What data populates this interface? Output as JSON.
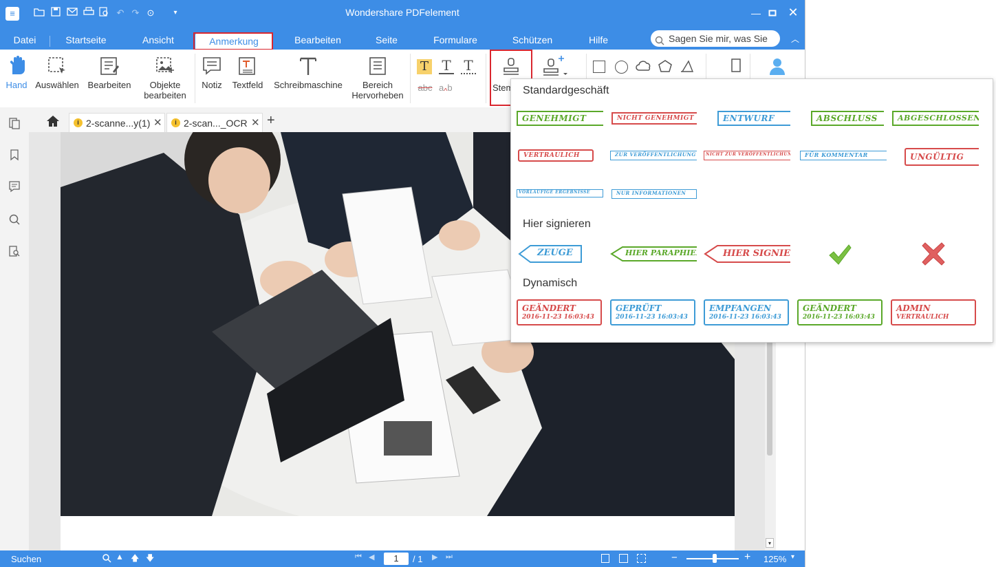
{
  "app": {
    "title": "Wondershare PDFelement"
  },
  "menu": {
    "file": "Datei",
    "tabs": [
      "Startseite",
      "Ansicht",
      "Anmerkung",
      "Bearbeiten",
      "Seite",
      "Formulare",
      "Schützen",
      "Hilfe"
    ],
    "active_tab": "Anmerkung",
    "search_placeholder": "Sagen Sie mir, was Sie tun"
  },
  "ribbon": {
    "hand": "Hand",
    "select": "Auswählen",
    "edit": "Bearbeiten",
    "objects_line1": "Objekte",
    "objects_line2": "bearbeiten",
    "note": "Notiz",
    "textbox": "Textfeld",
    "typewriter": "Schreibmaschine",
    "area_line1": "Bereich",
    "area_line2": "Hervorheben",
    "strike": "abc",
    "stamp": "Stem"
  },
  "doc_tabs": [
    {
      "label": "2-scanne...y(1)"
    },
    {
      "label": "2-scan..._OCR"
    }
  ],
  "stamp_panel": {
    "section1": "Standardgeschäft",
    "section2": "Hier signieren",
    "section3": "Dynamisch",
    "standard": [
      {
        "text": "GENEHMIGT",
        "color": "#5aa829"
      },
      {
        "text": "NICHT GENEHMIGT",
        "color": "#d64a4a"
      },
      {
        "text": "ENTWURF",
        "color": "#3d9bd6"
      },
      {
        "text": "ABSCHLUSS",
        "color": "#5aa829"
      },
      {
        "text": "ABGESCHLOSSEN",
        "color": "#5aa829"
      },
      {
        "text": "VERTRAULICH",
        "color": "#d64a4a"
      },
      {
        "text": "ZUR VERÖFFENTLICHUNG",
        "color": "#3d9bd6"
      },
      {
        "text": "NICHT ZUR VERÖFFENTLICHUNG",
        "color": "#d64a4a"
      },
      {
        "text": "FÜR KOMMENTAR",
        "color": "#3d9bd6"
      },
      {
        "text": "UNGÜLTIG",
        "color": "#d64a4a"
      },
      {
        "text": "VORLÄUFIGE ERGEBNISSE",
        "color": "#3d9bd6"
      },
      {
        "text": "NUR INFORMATIONEN",
        "color": "#3d9bd6"
      }
    ],
    "sign": [
      {
        "text": "ZEUGE",
        "color": "#3d9bd6"
      },
      {
        "text": "HIER PARAPHIEREN",
        "color": "#5aa829"
      },
      {
        "text": "HIER SIGNIEREN",
        "color": "#d64a4a"
      }
    ],
    "dynamic": [
      {
        "line1": "GEÄNDERT",
        "line2": "2016-11-23 16:03:43",
        "color": "#d64a4a"
      },
      {
        "line1": "GEPRÜFT",
        "line2": "2016-11-23 16:03:43",
        "color": "#3d9bd6"
      },
      {
        "line1": "EMPFANGEN",
        "line2": "2016-11-23 16:03:43",
        "color": "#3d9bd6"
      },
      {
        "line1": "GEÄNDERT",
        "line2": "2016-11-23 16:03:43",
        "color": "#5aa829"
      },
      {
        "line1": "ADMIN",
        "line2": "VERTRAULICH",
        "color": "#d64a4a"
      }
    ]
  },
  "status": {
    "search": "Suchen",
    "page_current": "1",
    "page_total": "/ 1",
    "zoom": "125%"
  },
  "colors": {
    "accent": "#3d8de6",
    "highlight_border": "#d9262e"
  }
}
